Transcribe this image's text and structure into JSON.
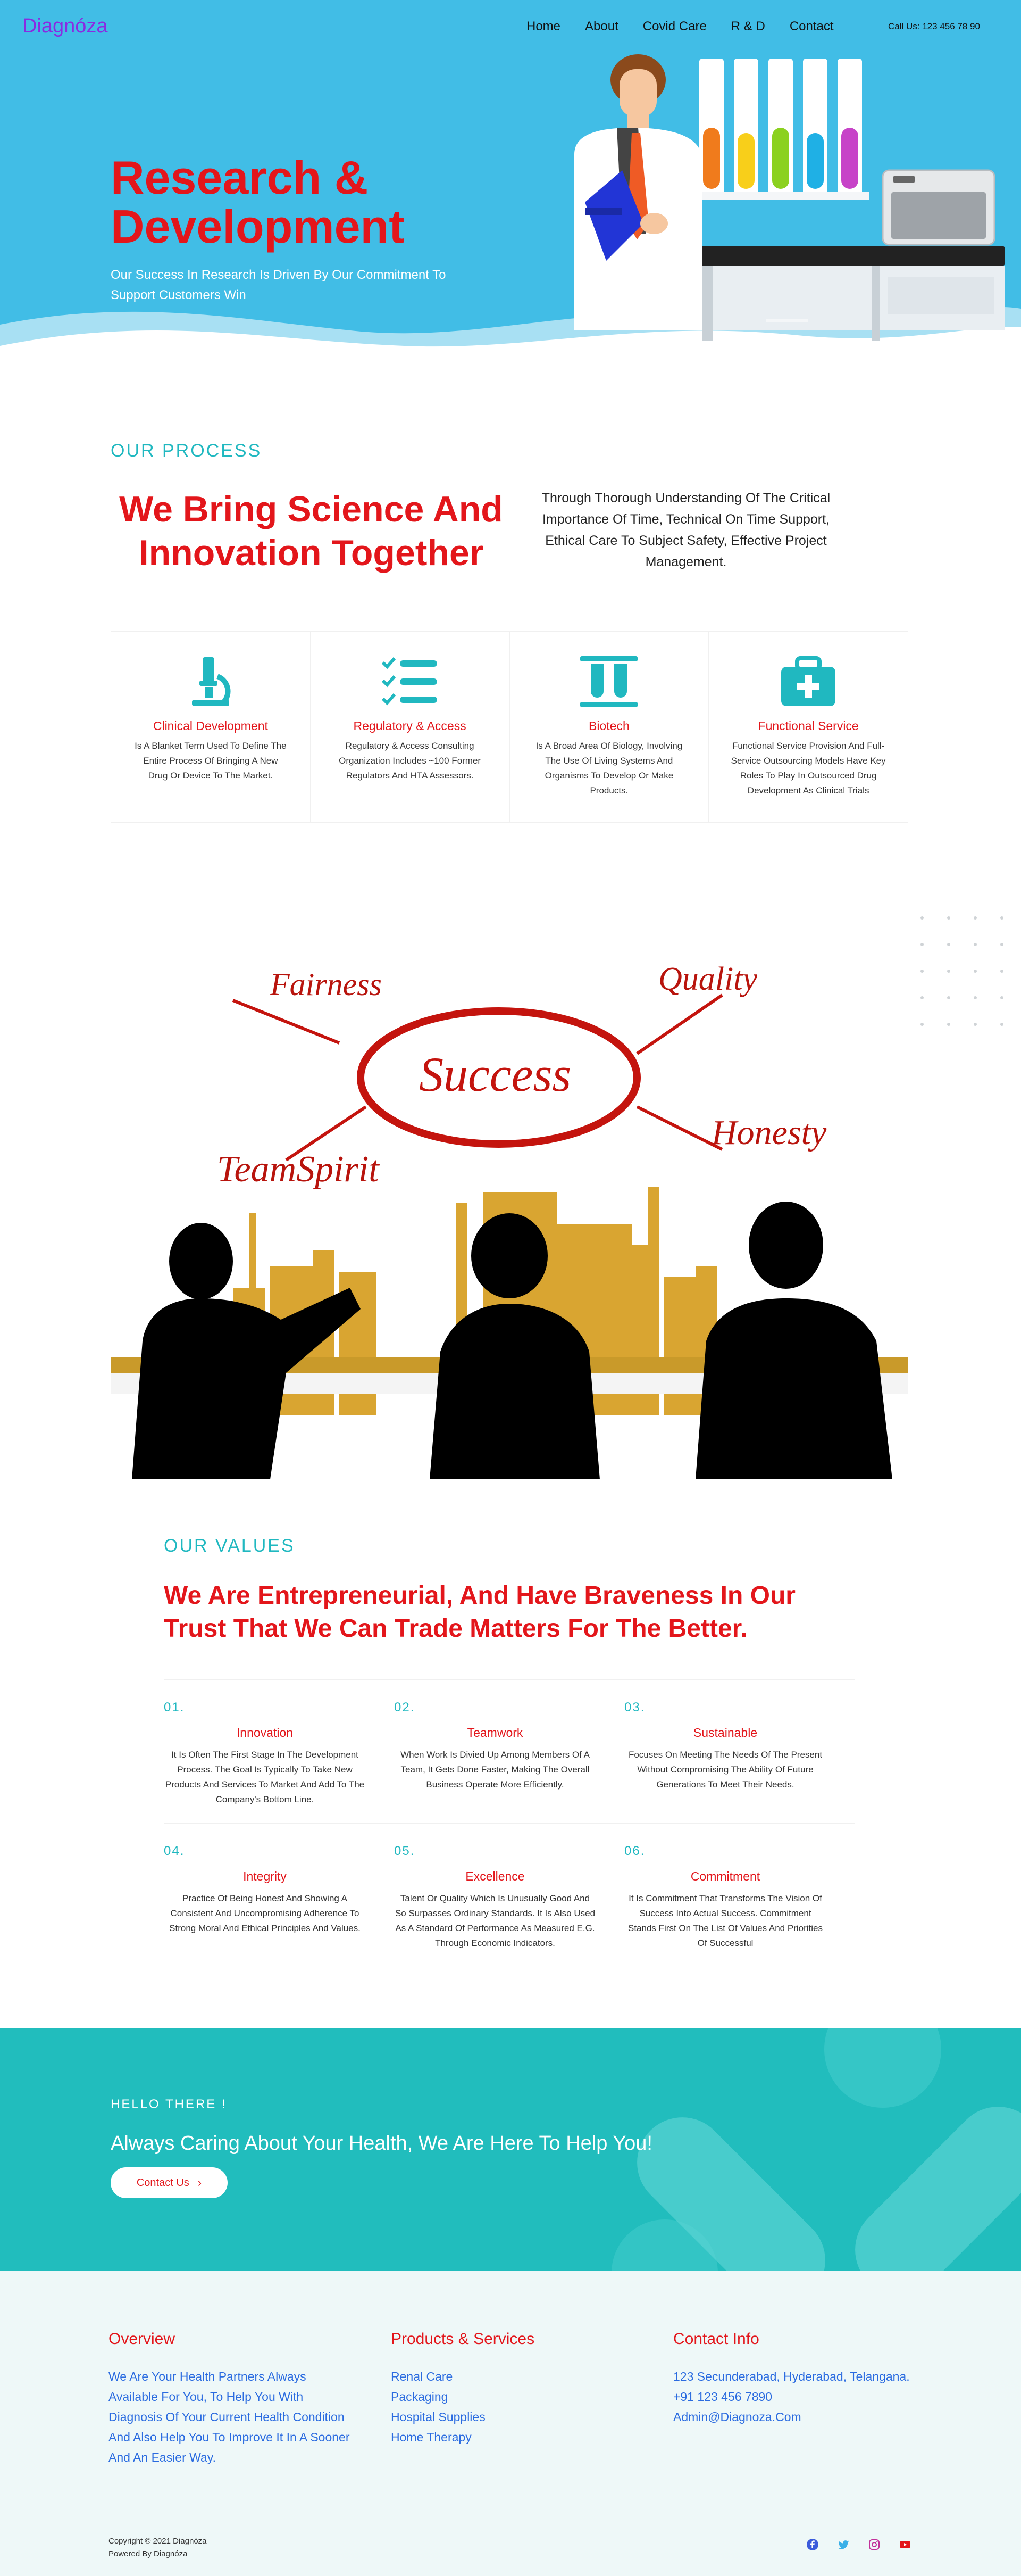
{
  "header": {
    "logo": "Diagnóza",
    "nav": [
      "Home",
      "About",
      "Covid Care",
      "R & D",
      "Contact"
    ],
    "call": "Call Us: 123 456 78 90"
  },
  "hero": {
    "title": "Research & Development",
    "subtitle": "Our Success In Research Is Driven By Our Commitment To Support Customers Win"
  },
  "process": {
    "eyebrow": "OUR PROCESS",
    "title": "We Bring Science And Innovation Together",
    "description": "Through Thorough Understanding Of The Critical Importance Of Time, Technical On Time Support, Ethical Care To Subject Safety, Effective Project Management.",
    "cards": [
      {
        "icon": "microscope-icon",
        "title": "Clinical Development",
        "desc": "Is A Blanket Term Used To Define The Entire Process Of Bringing A New Drug Or Device To The Market."
      },
      {
        "icon": "checklist-icon",
        "title": "Regulatory & Access",
        "desc": "Regulatory & Access Consulting Organization Includes ~100 Former Regulators And HTA Assessors."
      },
      {
        "icon": "test-tubes-icon",
        "title": "Biotech",
        "desc": "Is A Broad Area Of Biology, Involving The Use Of Living Systems And Organisms To Develop Or Make Products."
      },
      {
        "icon": "medical-kit-icon",
        "title": "Functional Service",
        "desc": "Functional Service Provision And Full-Service Outsourcing Models Have Key Roles To Play In Outsourced Drug Development As Clinical Trials"
      }
    ]
  },
  "illustration": {
    "words": [
      "Fairness",
      "Quality",
      "Success",
      "Honesty",
      "TeamSpirit"
    ]
  },
  "values": {
    "eyebrow": "OUR VALUES",
    "title": "We Are Entrepreneurial, And Have Braveness In Our Trust That We Can Trade Matters For The Better.",
    "items": [
      {
        "num": "01.",
        "title": "Innovation",
        "desc": "It Is Often The First Stage In The Development Process. The Goal Is Typically To Take New Products And Services To Market And Add To The Company's Bottom Line."
      },
      {
        "num": "02.",
        "title": "Teamwork",
        "desc": "When Work Is Divied Up Among Members Of A Team, It Gets Done Faster, Making The Overall Business Operate More Efficiently."
      },
      {
        "num": "03.",
        "title": "Sustainable",
        "desc": "Focuses On Meeting The Needs Of The Present Without Compromising The Ability Of Future Generations To Meet Their Needs."
      },
      {
        "num": "04.",
        "title": "Integrity",
        "desc": "Practice Of Being Honest And Showing A Consistent And Uncompromising Adherence To Strong Moral And Ethical Principles And Values."
      },
      {
        "num": "05.",
        "title": "Excellence",
        "desc": "Talent Or Quality Which Is Unusually Good And So Surpasses Ordinary Standards. It Is Also Used As A Standard Of Performance As Measured E.G. Through Economic Indicators."
      },
      {
        "num": "06.",
        "title": "Commitment",
        "desc": "It Is Commitment That Transforms The Vision Of Success Into Actual Success. Commitment Stands First On The List Of Values And Priorities Of Successful"
      }
    ]
  },
  "cta": {
    "eyebrow": "HELLO THERE !",
    "title": "Always Caring About Your Health, We Are Here To Help You!",
    "button": "Contact Us",
    "button_icon": "chevron-right-icon"
  },
  "footer": {
    "overview_title": "Overview",
    "overview_text": "We  Are Your Health Partners Always Available For You, To Help You With Diagnosis Of Your Current Health Condition And Also Help You To Improve It In A Sooner And An Easier Way.",
    "products_title": "Products & Services",
    "products": [
      "Renal Care",
      "Packaging",
      "Hospital Supplies",
      "Home Therapy"
    ],
    "contact_title": "Contact Info",
    "contact": [
      "123 Secunderabad, Hyderabad, Telangana.",
      "+91 123 456 7890",
      "Admin@Diagnoza.Com"
    ],
    "copyright": "Copyright © 2021 Diagnóza",
    "powered": "Powered By Diagnóza",
    "social_icons": [
      "facebook-icon",
      "twitter-icon",
      "instagram-icon",
      "youtube-icon"
    ]
  },
  "colors": {
    "accent_red": "#e3161b",
    "teal": "#20b8c0",
    "hero_blue": "#41bde6",
    "logo_purple": "#8a2be2",
    "link_blue": "#2a6be0"
  }
}
